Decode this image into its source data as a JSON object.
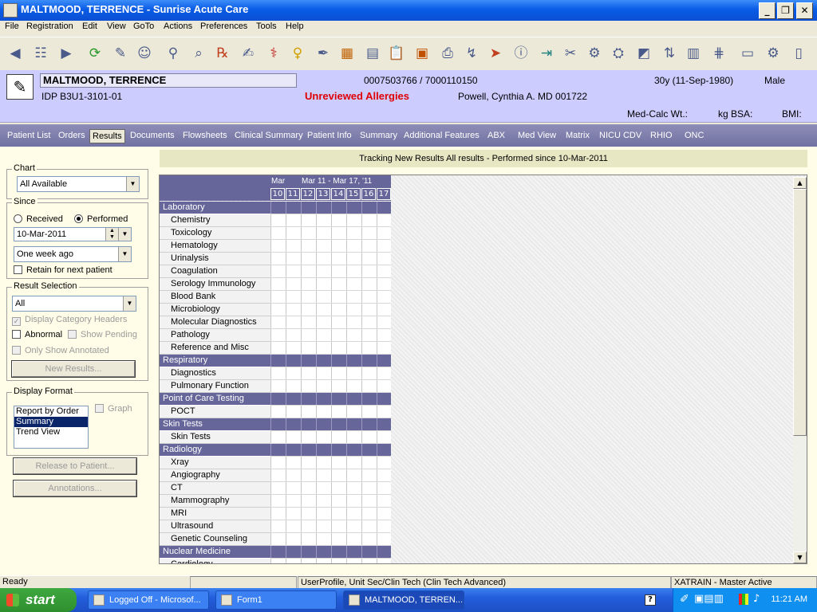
{
  "window": {
    "title": "MALTMOOD, TERRENCE - Sunrise Acute Care"
  },
  "menu": [
    "File",
    "Registration",
    "Edit",
    "View",
    "GoTo",
    "Actions",
    "Preferences",
    "Tools",
    "Help"
  ],
  "banner": {
    "patient_name": "MALTMOOD, TERRENCE",
    "idp": "IDP B3U1-3101-01",
    "mrn": "0007503766 / 7000110150",
    "allergy_alert": "Unreviewed Allergies",
    "physician": "Powell, Cynthia A. MD 001722",
    "age_dob": "30y (11-Sep-1980)",
    "sex": "Male",
    "medcalc": "Med-Calc Wt.:",
    "kg_bsa": "kg  BSA:",
    "bmi": "BMI:",
    "allergy_color": "#e00000",
    "background_color": "#ccccff"
  },
  "tabs": [
    "Patient List",
    "Orders",
    "Results",
    "Documents",
    "Flowsheets",
    "Clinical Summary",
    "Patient Info",
    "Summary",
    "Additional Features",
    "ABX",
    "Med View",
    "Matrix",
    "NICU CDV",
    "RHIO",
    "ONC"
  ],
  "active_tab": "Results",
  "left": {
    "chart_label": "Chart",
    "chart_value": "All Available",
    "since_label": "Since",
    "received": "Received",
    "performed": "Performed",
    "since_date": "10-Mar-2011",
    "since_range": "One week ago",
    "retain": "Retain for next patient",
    "result_selection_label": "Result Selection",
    "result_selection_value": "All",
    "display_category_headers": "Display Category Headers",
    "abnormal": "Abnormal",
    "show_pending": "Show Pending",
    "only_show_annotated": "Only Show Annotated",
    "new_results": "New Results...",
    "display_format_label": "Display Format",
    "formats": [
      "Report by Order",
      "Summary",
      "Trend View"
    ],
    "selected_format": "Summary",
    "graph": "Graph",
    "release": "Release to Patient...",
    "annotations": "Annotations..."
  },
  "results": {
    "tracking_header": "Tracking New Results All results - Performed since 10-Mar-2011",
    "date_header_month": "Mar",
    "date_header_range": "Mar 11 - Mar 17, '11",
    "days": [
      "10",
      "11",
      "12",
      "13",
      "14",
      "15",
      "16",
      "17"
    ],
    "rows": [
      {
        "label": "Laboratory",
        "type": "category"
      },
      {
        "label": "Chemistry",
        "type": "item"
      },
      {
        "label": "Toxicology",
        "type": "item"
      },
      {
        "label": "Hematology",
        "type": "item"
      },
      {
        "label": "Urinalysis",
        "type": "item"
      },
      {
        "label": "Coagulation",
        "type": "item"
      },
      {
        "label": "Serology Immunology",
        "type": "item"
      },
      {
        "label": "Blood Bank",
        "type": "item"
      },
      {
        "label": "Microbiology",
        "type": "item"
      },
      {
        "label": "Molecular Diagnostics",
        "type": "item"
      },
      {
        "label": "Pathology",
        "type": "item"
      },
      {
        "label": "Reference and Misc",
        "type": "item"
      },
      {
        "label": "Respiratory",
        "type": "category"
      },
      {
        "label": "Diagnostics",
        "type": "item"
      },
      {
        "label": "Pulmonary Function",
        "type": "item"
      },
      {
        "label": "Point of Care Testing",
        "type": "category"
      },
      {
        "label": "POCT",
        "type": "item"
      },
      {
        "label": "Skin Tests",
        "type": "category"
      },
      {
        "label": "Skin Tests",
        "type": "item"
      },
      {
        "label": "Radiology",
        "type": "category"
      },
      {
        "label": "Xray",
        "type": "item"
      },
      {
        "label": "Angiography",
        "type": "item"
      },
      {
        "label": "CT",
        "type": "item"
      },
      {
        "label": "Mammography",
        "type": "item"
      },
      {
        "label": "MRI",
        "type": "item"
      },
      {
        "label": "Ultrasound",
        "type": "item"
      },
      {
        "label": "Genetic Counseling",
        "type": "item"
      },
      {
        "label": "Nuclear Medicine",
        "type": "category"
      },
      {
        "label": "Cardiology",
        "type": "item"
      }
    ]
  },
  "status": {
    "ready": "Ready",
    "profile": "UserProfile, Unit Sec/Clin Tech (Clin Tech Advanced)",
    "env": "XATRAIN - Master Active"
  },
  "taskbar": {
    "start": "start",
    "tasks": [
      "Logged Off - Microsof...",
      "Form1",
      "MALTMOOD, TERREN..."
    ],
    "clock": "11:21 AM"
  }
}
